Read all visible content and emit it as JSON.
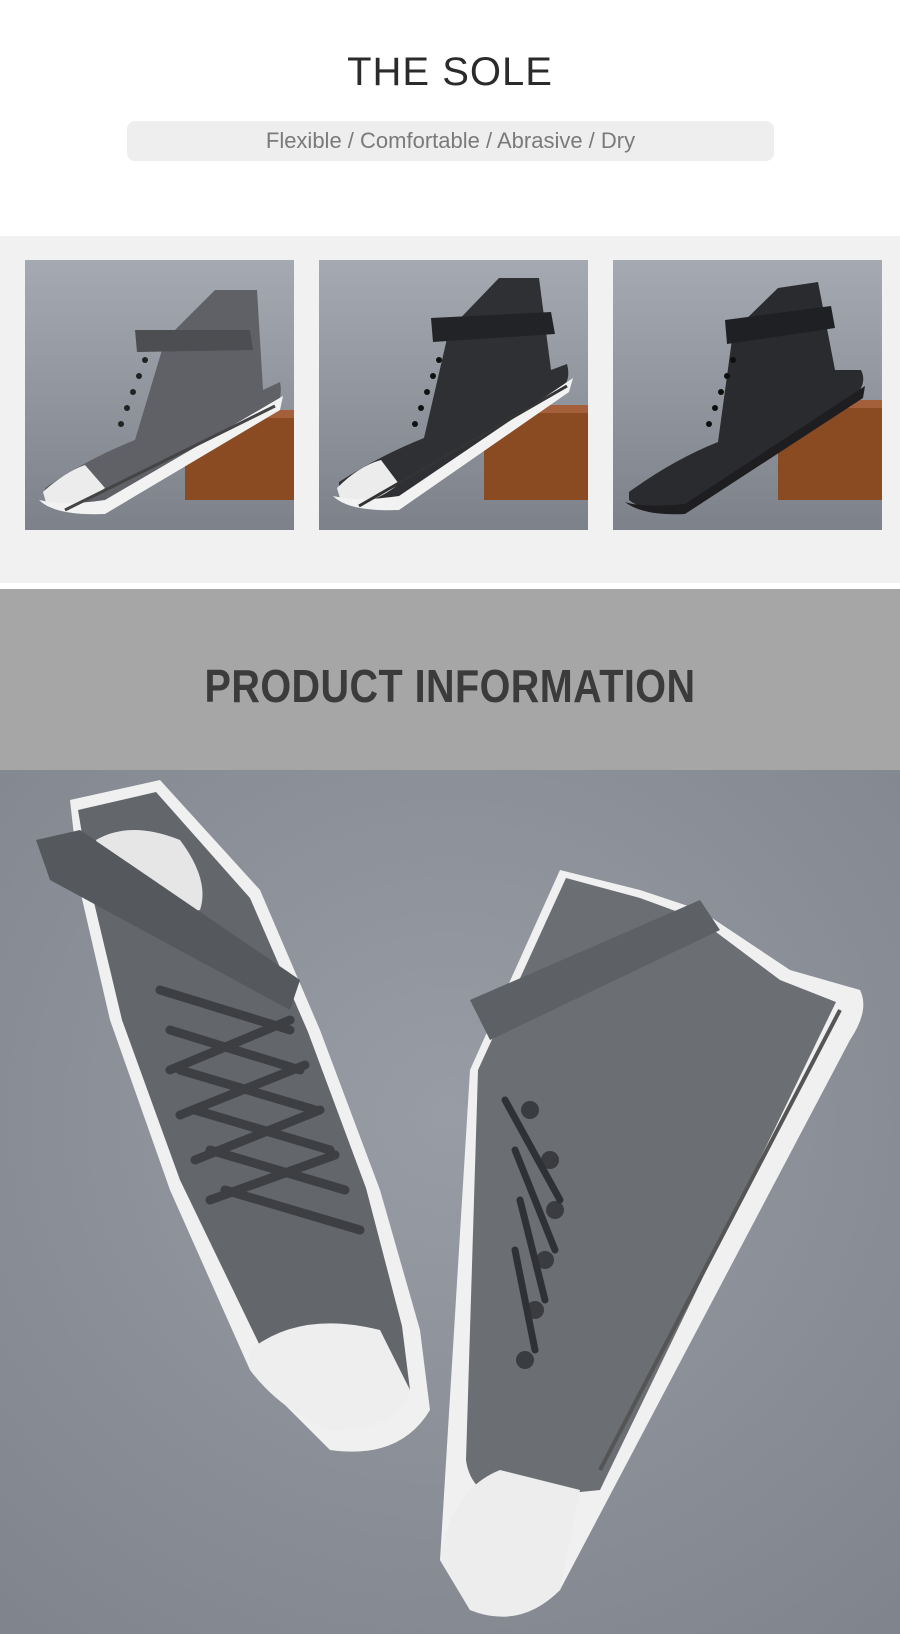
{
  "sole_section": {
    "title": "THE SOLE",
    "features": "Flexible / Comfortable / Abrasive / Dry"
  },
  "gallery": {
    "items": [
      {
        "icon": "sneaker-grey-photo",
        "upper_color": "#5f6166",
        "sole_color": "#f2f2f2"
      },
      {
        "icon": "sneaker-black-white-sole-photo",
        "upper_color": "#2e3034",
        "sole_color": "#f2f2f2"
      },
      {
        "icon": "sneaker-all-black-photo",
        "upper_color": "#2a2b2e",
        "sole_color": "#1e1e20"
      }
    ]
  },
  "product_info": {
    "title": "PRODUCT INFORMATION"
  },
  "hero": {
    "icon": "sneaker-pair-photo",
    "background_color": "#8c9098",
    "upper_color": "#63666b"
  }
}
